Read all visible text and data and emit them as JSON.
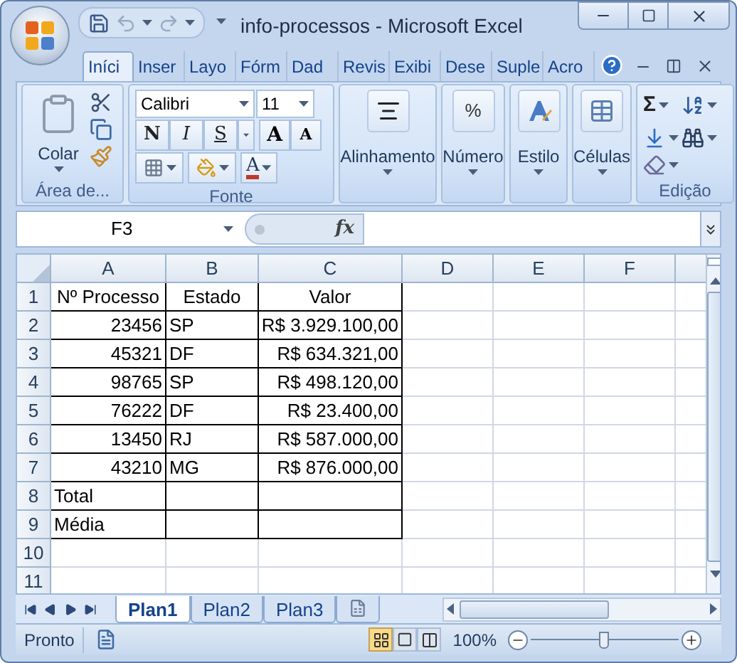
{
  "window": {
    "title": "info-processos - Microsoft Excel"
  },
  "ribbon_tabs": [
    {
      "label": "Iníci",
      "selected": true
    },
    {
      "label": "Inser",
      "selected": false
    },
    {
      "label": "Layo",
      "selected": false
    },
    {
      "label": "Fórm",
      "selected": false
    },
    {
      "label": "Dad",
      "selected": false
    },
    {
      "label": "Revis",
      "selected": false
    },
    {
      "label": "Exibi",
      "selected": false
    },
    {
      "label": "Dese",
      "selected": false
    },
    {
      "label": "Suple",
      "selected": false
    },
    {
      "label": "Acro",
      "selected": false
    }
  ],
  "ribbon_groups": [
    {
      "kind": "clipboard",
      "label": "Área de...",
      "button": "Colar"
    },
    {
      "kind": "font",
      "label": "Fonte",
      "font": "Calibri",
      "size": "11",
      "styles": [
        "N",
        "I",
        "S"
      ],
      "grow": "A",
      "shrink": "A",
      "font_color": "A"
    },
    {
      "kind": "collapsed",
      "button": "Alinhamento"
    },
    {
      "kind": "collapsed",
      "button": "Número",
      "glyph": "%"
    },
    {
      "kind": "collapsed",
      "button": "Estilo"
    },
    {
      "kind": "collapsed",
      "button": "Células"
    },
    {
      "kind": "editing",
      "label": "Edição",
      "glyph": "Σ"
    }
  ],
  "formula_bar": {
    "name_box": "F3",
    "fx": "fx"
  },
  "columns": [
    "A",
    "B",
    "C",
    "D",
    "E",
    "F"
  ],
  "rows": [
    {
      "number": "1",
      "cells": [
        {
          "text": "Nº Processo",
          "kind": "header"
        },
        {
          "text": "Estado",
          "kind": "header"
        },
        {
          "text": "Valor",
          "kind": "header"
        }
      ]
    },
    {
      "number": "2",
      "cells": [
        {
          "text": "23456",
          "kind": "number"
        },
        {
          "text": "SP",
          "kind": "text"
        },
        {
          "text": "R$ 3.929.100,00",
          "kind": "number"
        }
      ]
    },
    {
      "number": "3",
      "cells": [
        {
          "text": "45321",
          "kind": "number"
        },
        {
          "text": "DF",
          "kind": "text"
        },
        {
          "text": "R$ 634.321,00",
          "kind": "number"
        }
      ]
    },
    {
      "number": "4",
      "cells": [
        {
          "text": "98765",
          "kind": "number"
        },
        {
          "text": "SP",
          "kind": "text"
        },
        {
          "text": "R$ 498.120,00",
          "kind": "number"
        }
      ]
    },
    {
      "number": "5",
      "cells": [
        {
          "text": "76222",
          "kind": "number"
        },
        {
          "text": "DF",
          "kind": "text"
        },
        {
          "text": "R$ 23.400,00",
          "kind": "number"
        }
      ]
    },
    {
      "number": "6",
      "cells": [
        {
          "text": "13450",
          "kind": "number"
        },
        {
          "text": "RJ",
          "kind": "text"
        },
        {
          "text": "R$ 587.000,00",
          "kind": "number"
        }
      ]
    },
    {
      "number": "7",
      "cells": [
        {
          "text": "43210",
          "kind": "number"
        },
        {
          "text": "MG",
          "kind": "text"
        },
        {
          "text": "R$ 876.000,00",
          "kind": "number"
        }
      ]
    },
    {
      "number": "8",
      "cells": [
        {
          "text": "Total",
          "kind": "text"
        },
        {},
        {}
      ]
    },
    {
      "number": "9",
      "cells": [
        {
          "text": "Média",
          "kind": "text"
        },
        {},
        {}
      ]
    },
    {
      "number": "10"
    },
    {
      "number": "11"
    }
  ],
  "sheet_tabs": [
    {
      "label": "Plan1",
      "selected": true
    },
    {
      "label": "Plan2",
      "selected": false
    },
    {
      "label": "Plan3",
      "selected": false
    }
  ],
  "status_bar": {
    "text": "Pronto",
    "views": [
      {
        "selected": true
      },
      {
        "selected": false
      },
      {
        "selected": false
      }
    ],
    "zoom": "100%",
    "zoom_slider": {
      "level": 0.5
    }
  }
}
